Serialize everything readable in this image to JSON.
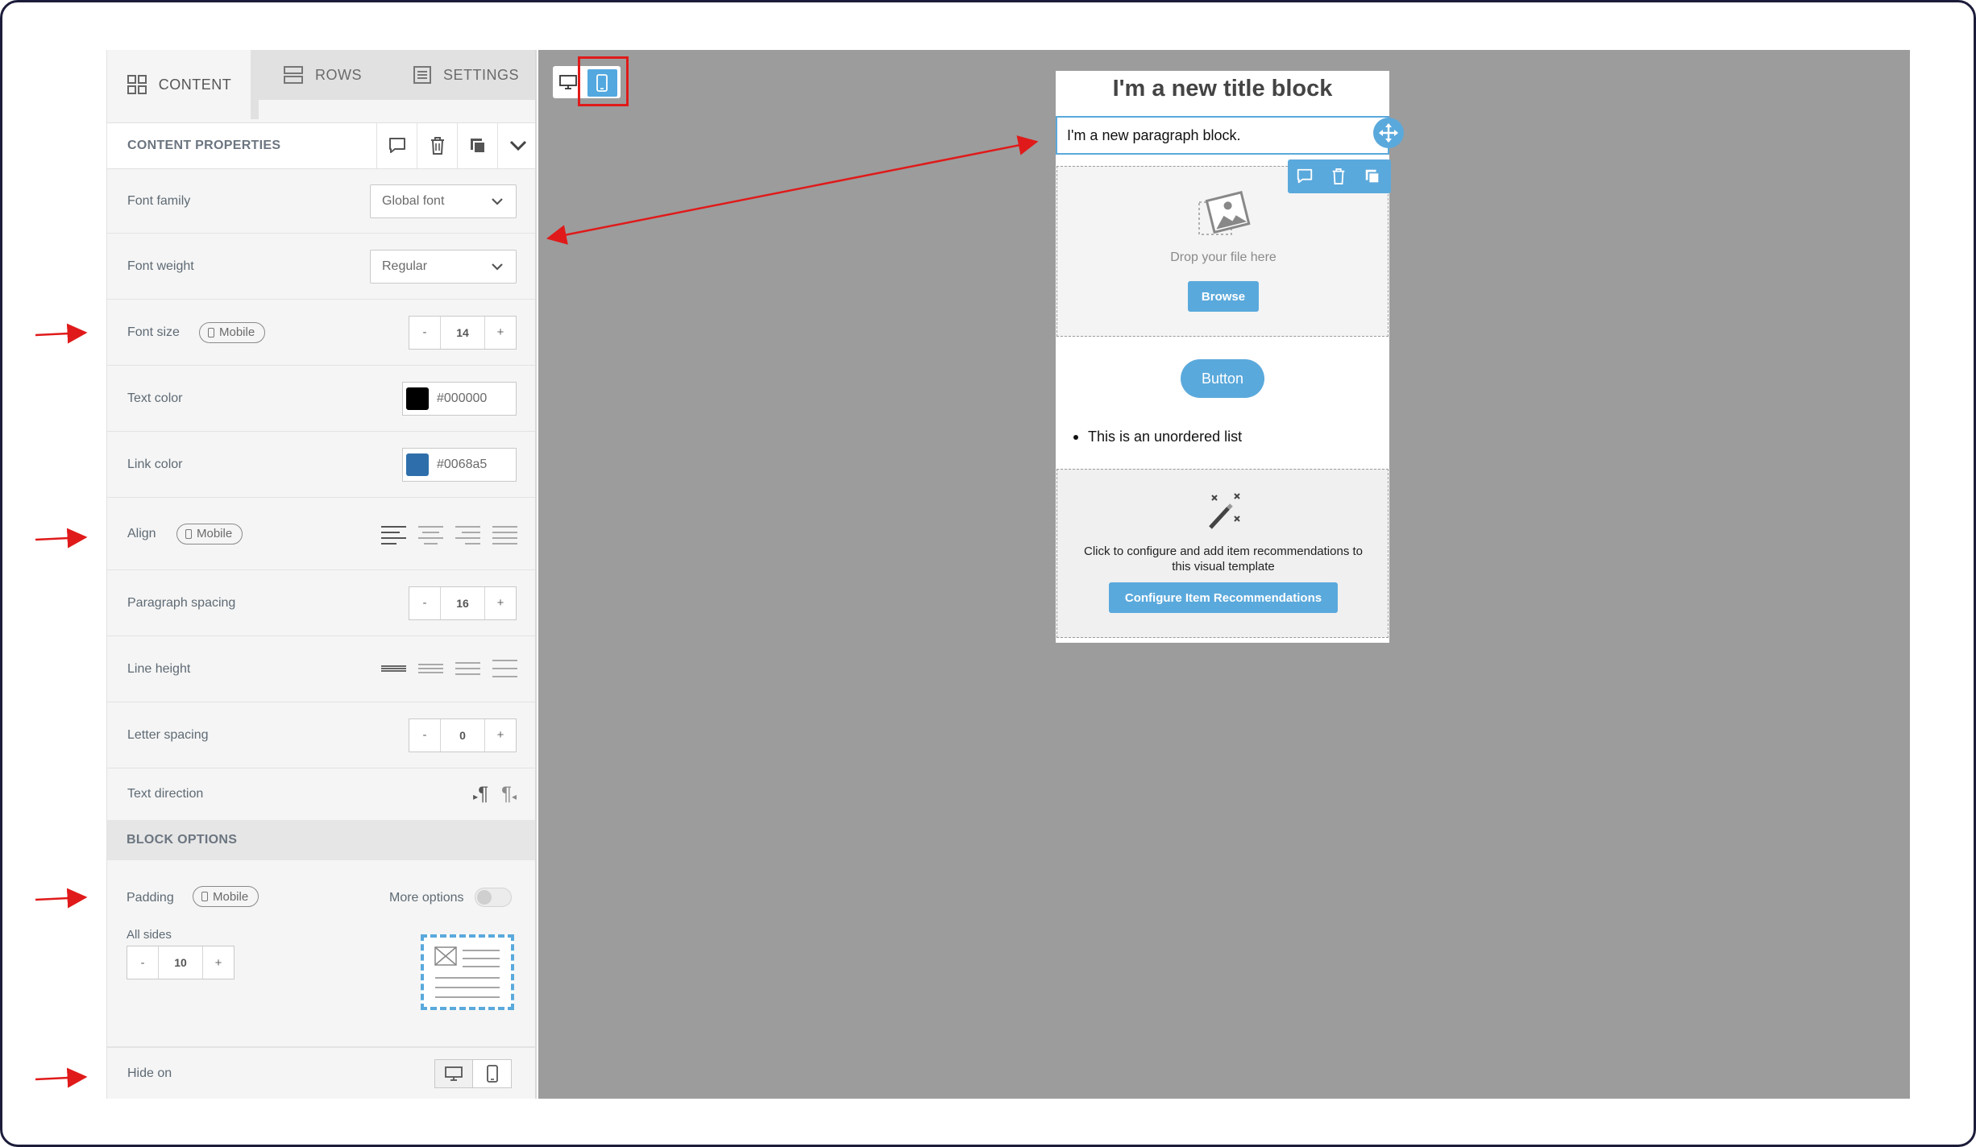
{
  "tabs": [
    {
      "label": "CONTENT",
      "icon": "grid-icon",
      "active": true
    },
    {
      "label": "ROWS",
      "icon": "rows-icon",
      "active": false
    },
    {
      "label": "SETTINGS",
      "icon": "settings-list-icon",
      "active": false
    }
  ],
  "content_properties": {
    "title": "CONTENT PROPERTIES",
    "font_family": {
      "label": "Font family",
      "value": "Global font"
    },
    "font_weight": {
      "label": "Font weight",
      "value": "Regular"
    },
    "font_size": {
      "label": "Font size",
      "badge": "Mobile",
      "value": "14",
      "minus": "-",
      "plus": "+"
    },
    "text_color": {
      "label": "Text color",
      "value": "#000000",
      "swatch": "#000000"
    },
    "link_color": {
      "label": "Link color",
      "value": "#0068a5",
      "swatch": "#2e6fab"
    },
    "align": {
      "label": "Align",
      "badge": "Mobile"
    },
    "paragraph_spacing": {
      "label": "Paragraph spacing",
      "value": "16",
      "minus": "-",
      "plus": "+"
    },
    "line_height": {
      "label": "Line height"
    },
    "letter_spacing": {
      "label": "Letter spacing",
      "value": "0",
      "minus": "-",
      "plus": "+"
    },
    "text_direction": {
      "label": "Text direction",
      "ltr": "¶",
      "rtl": "¶"
    }
  },
  "block_options": {
    "title": "BLOCK OPTIONS",
    "padding": {
      "label": "Padding",
      "badge": "Mobile",
      "more_options": "More options",
      "all_sides": "All sides",
      "value": "10",
      "minus": "-",
      "plus": "+"
    },
    "hide_on": {
      "label": "Hide on"
    }
  },
  "email": {
    "title": "I'm a new title block",
    "paragraph": "I'm a new paragraph block.",
    "image_drop": "Drop your file here",
    "browse": "Browse",
    "button": "Button",
    "list_item": "This is an unordered list",
    "recommendation_text": "Click to configure and add item recommendations to this visual template",
    "configure_button": "Configure Item Recommendations"
  },
  "colors": {
    "accent": "#5aa9dc",
    "annotation": "#e01a1a",
    "canvas": "#9c9c9c"
  }
}
